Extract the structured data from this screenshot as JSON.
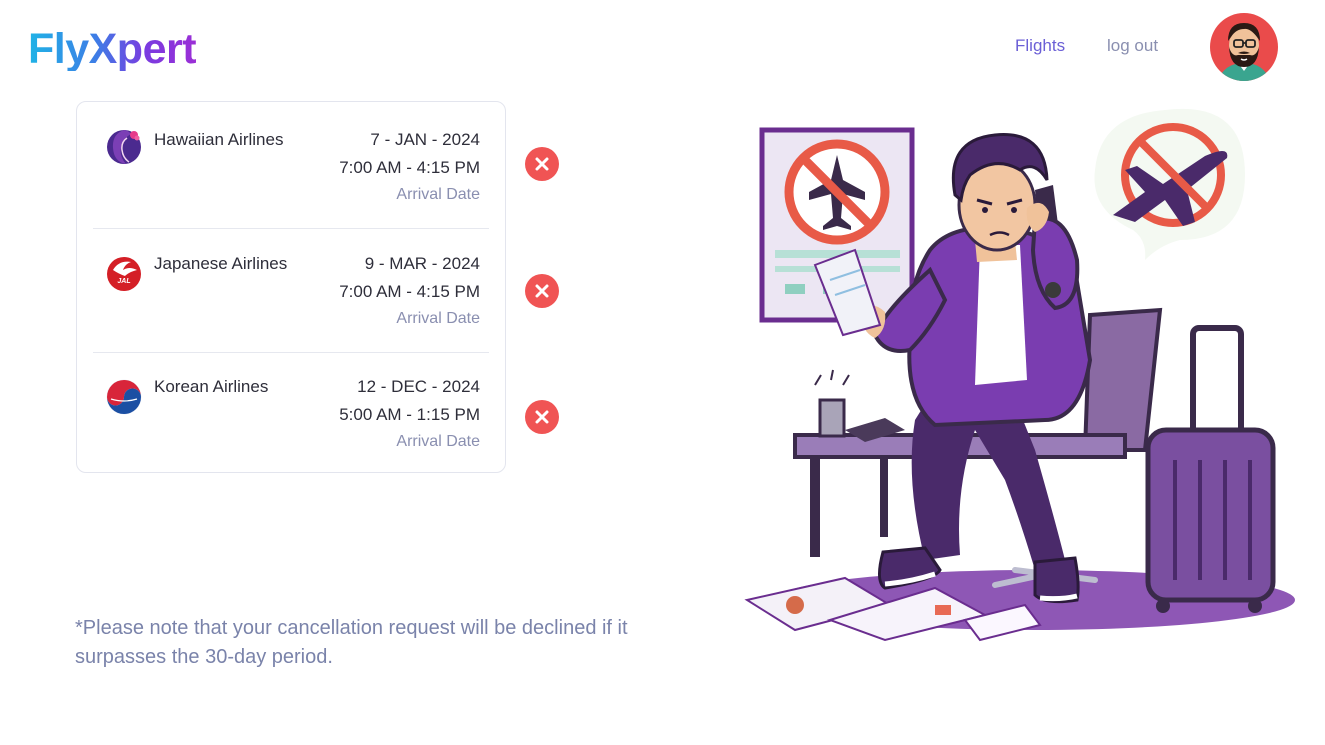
{
  "brand": {
    "name": "FlyXpert"
  },
  "nav": {
    "flights": "Flights",
    "logout": "log out"
  },
  "flights": [
    {
      "airline": "Hawaiian Airlines",
      "date": "7 - JAN - 2024",
      "time": "7:00 AM - 4:15 PM",
      "arrival_label": "Arrival Date",
      "logo_icon": "hawaiian-airlines-logo"
    },
    {
      "airline": "Japanese Airlines",
      "date": "9 - MAR - 2024",
      "time": "7:00 AM - 4:15 PM",
      "arrival_label": "Arrival Date",
      "logo_icon": "jal-logo",
      "logo_text": "JAL"
    },
    {
      "airline": "Korean Airlines",
      "date": "12 - DEC - 2024",
      "time": "5:00 AM - 1:15 PM",
      "arrival_label": "Arrival Date",
      "logo_icon": "korean-air-logo"
    }
  ],
  "note": "*Please note that your cancellation request will be declined if it surpasses the 30-day period.",
  "colors": {
    "accent": "#6b5fd6",
    "cancel": "#f05454",
    "muted": "#8a8fb0",
    "illustration_purple": "#6a2d8f"
  }
}
